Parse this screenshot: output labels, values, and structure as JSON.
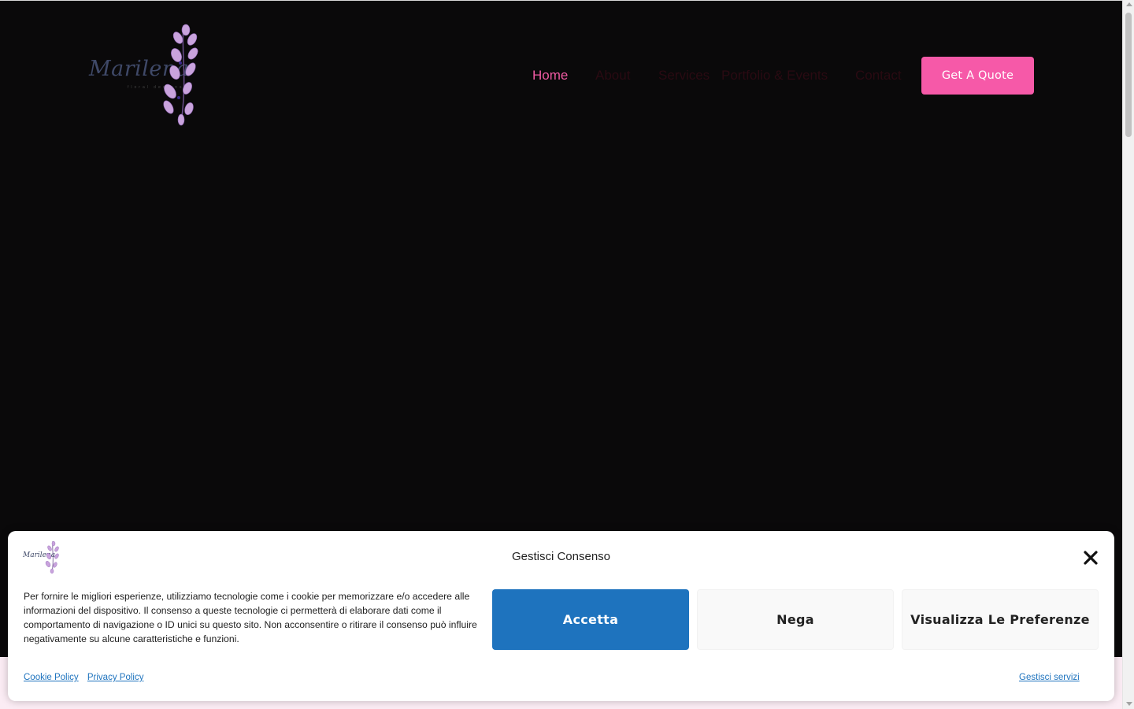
{
  "header": {
    "logo_text": "Marilena",
    "logo_subtext": "floral designs",
    "nav": [
      {
        "label": "Home",
        "active": true
      },
      {
        "label": "About",
        "active": false
      },
      {
        "label": "Services",
        "active": false
      },
      {
        "label": "Portfolio & Events",
        "active": false
      },
      {
        "label": "Contact",
        "active": false
      }
    ],
    "cta_label": "Get A Quote"
  },
  "consent": {
    "logo_text": "Marilena",
    "title": "Gestisci Consenso",
    "message": "Per fornire le migliori esperienze, utilizziamo tecnologie come i cookie per memorizzare e/o accedere alle informazioni del dispositivo. Il consenso a queste tecnologie ci permetterà di elaborare dati come il comportamento di navigazione o ID unici su questo sito. Non acconsentire o ritirare il consenso può influire negativamente su alcune caratteristiche e funzioni.",
    "accept_label": "Accetta",
    "deny_label": "Nega",
    "preferences_label": "Visualizza Le Preferenze",
    "links": [
      "Cookie Policy",
      "Privacy Policy"
    ],
    "manage_services_label": "Gestisci servizi"
  },
  "colors": {
    "accent_pink": "#f659a8",
    "accept_blue": "#1e73be",
    "background": "#0a090a"
  }
}
